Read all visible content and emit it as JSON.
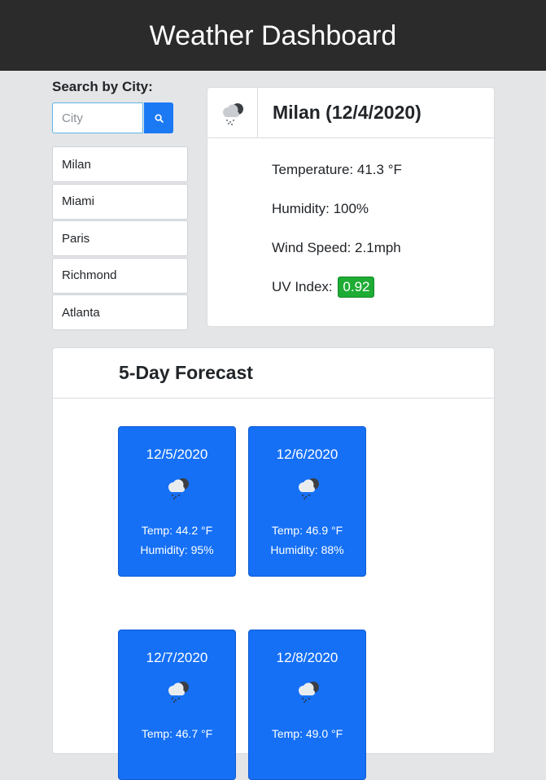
{
  "header": {
    "title": "Weather Dashboard"
  },
  "search": {
    "label": "Search by City:",
    "placeholder": "City",
    "value": "",
    "button_icon": "search-icon"
  },
  "cities": [
    {
      "label": "Milan"
    },
    {
      "label": "Miami"
    },
    {
      "label": "Paris"
    },
    {
      "label": "Richmond"
    },
    {
      "label": "Atlanta"
    }
  ],
  "current": {
    "icon": "snow-cloud-icon",
    "title": "Milan (12/4/2020)",
    "temperature": "Temperature: 41.3 °F",
    "humidity": "Humidity: 100%",
    "wind": "Wind Speed: 2.1mph",
    "uv_label": "UV Index:",
    "uv_value": "0.92",
    "uv_color": "#1eac34"
  },
  "forecast": {
    "title": "5-Day Forecast",
    "days": [
      {
        "date": "12/5/2020",
        "icon": "snow-cloud-icon",
        "temp": "Temp: 44.2 °F",
        "humidity": "Humidity: 95%"
      },
      {
        "date": "12/6/2020",
        "icon": "snow-cloud-icon",
        "temp": "Temp: 46.9 °F",
        "humidity": "Humidity: 88%"
      },
      {
        "date": "12/7/2020",
        "icon": "snow-cloud-icon",
        "temp": "Temp: 46.7 °F",
        "humidity": ""
      },
      {
        "date": "12/8/2020",
        "icon": "snow-cloud-icon",
        "temp": "Temp: 49.0 °F",
        "humidity": ""
      }
    ]
  },
  "colors": {
    "header_bg": "#2b2b2b",
    "accent": "#1570f6",
    "page_bg": "#e4e5e7"
  }
}
